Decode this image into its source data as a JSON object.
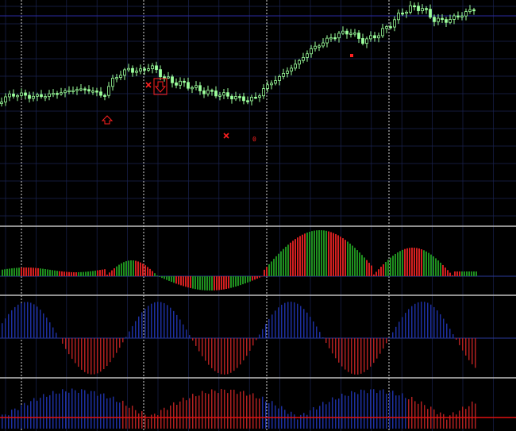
{
  "colors": {
    "background": "#000000",
    "grid": "#1a2350",
    "separator": "#c0c0c0",
    "sessionLine": "#d8d8d8",
    "candle": "#9cff9c",
    "resistanceLine": "#2a2aa0",
    "markerRed": "#ff2020",
    "histGreen": "#1f8f1f",
    "histRed": "#d42020",
    "histBlue": "#1d2fa0",
    "histRedDark": "#b02020",
    "hLineRed": "#e01010",
    "zeroLine": "#2a3a9a"
  },
  "icons": {
    "sellArrow": "red-down-arrow-icon",
    "buyArrow": "red-up-arrow-icon",
    "cross": "red-x-icon",
    "dot": "red-square-dot-icon"
  },
  "main_pane": {
    "label_value": "0",
    "price_path": [
      [
        0.0,
        0.62
      ],
      [
        0.03,
        0.58
      ],
      [
        0.06,
        0.6
      ],
      [
        0.09,
        0.59
      ],
      [
        0.12,
        0.57
      ],
      [
        0.15,
        0.55
      ],
      [
        0.18,
        0.56
      ],
      [
        0.2,
        0.6
      ],
      [
        0.22,
        0.48
      ],
      [
        0.25,
        0.42
      ],
      [
        0.27,
        0.44
      ],
      [
        0.29,
        0.4
      ],
      [
        0.31,
        0.45
      ],
      [
        0.33,
        0.5
      ],
      [
        0.36,
        0.52
      ],
      [
        0.39,
        0.56
      ],
      [
        0.42,
        0.58
      ],
      [
        0.45,
        0.6
      ],
      [
        0.48,
        0.62
      ],
      [
        0.5,
        0.6
      ],
      [
        0.51,
        0.55
      ],
      [
        0.53,
        0.5
      ],
      [
        0.55,
        0.45
      ],
      [
        0.58,
        0.37
      ],
      [
        0.6,
        0.3
      ],
      [
        0.62,
        0.26
      ],
      [
        0.64,
        0.22
      ],
      [
        0.66,
        0.19
      ],
      [
        0.68,
        0.18
      ],
      [
        0.7,
        0.24
      ],
      [
        0.72,
        0.22
      ],
      [
        0.74,
        0.18
      ],
      [
        0.76,
        0.12
      ],
      [
        0.78,
        0.05
      ],
      [
        0.8,
        0.02
      ],
      [
        0.82,
        0.03
      ],
      [
        0.84,
        0.1
      ],
      [
        0.86,
        0.11
      ],
      [
        0.88,
        0.09
      ],
      [
        0.9,
        0.06
      ],
      [
        0.92,
        0.03
      ]
    ]
  }
}
